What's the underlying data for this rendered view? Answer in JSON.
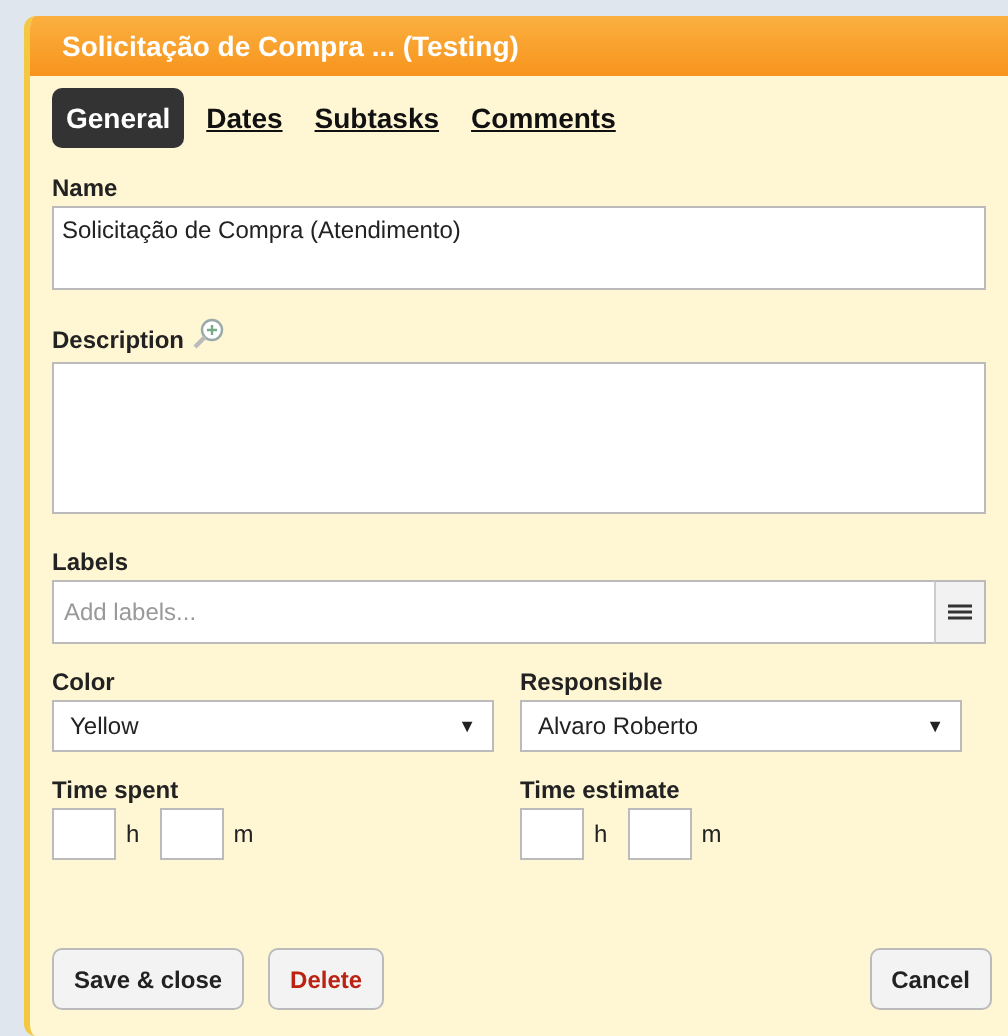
{
  "window": {
    "title": "Solicitação de Compra ... (Testing)"
  },
  "tabs": [
    {
      "label": "General",
      "selected": true
    },
    {
      "label": "Dates",
      "selected": false
    },
    {
      "label": "Subtasks",
      "selected": false
    },
    {
      "label": "Comments",
      "selected": false
    }
  ],
  "name": {
    "label": "Name",
    "value": "Solicitação de Compra (Atendimento)"
  },
  "description": {
    "label": "Description"
  },
  "labels": {
    "label": "Labels",
    "placeholder": "Add labels..."
  },
  "selects": [
    {
      "label": "Color",
      "value": "Yellow",
      "arrow": "▼"
    },
    {
      "label": "Responsible",
      "value": "Alvaro Roberto",
      "arrow": "▼"
    }
  ],
  "times": [
    {
      "label": "Time spent",
      "hours_unit": "h",
      "minutes_unit": "m"
    },
    {
      "label": "Time estimate",
      "hours_unit": "h",
      "minutes_unit": "m"
    }
  ],
  "buttons": [
    {
      "label": "Save & close",
      "kind": "normal"
    },
    {
      "label": "Delete",
      "kind": "danger"
    },
    {
      "label": "Cancel",
      "kind": "normal"
    }
  ]
}
